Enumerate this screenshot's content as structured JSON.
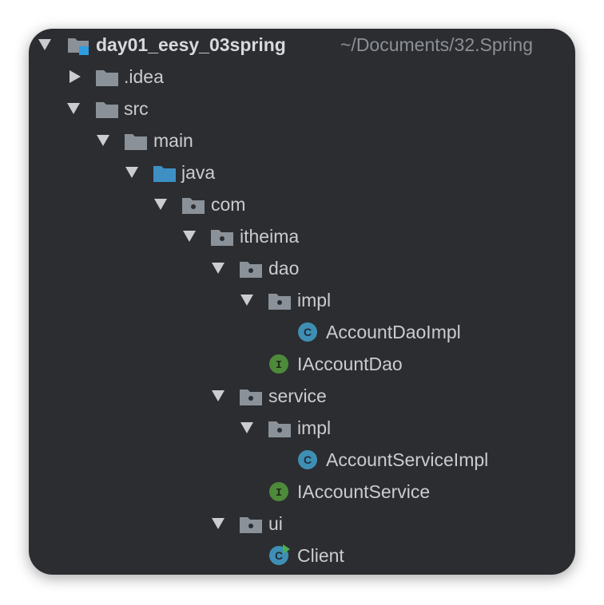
{
  "project": {
    "name": "day01_eesy_03spring",
    "path": "~/Documents/32.Spring"
  },
  "tree": {
    "idea": ".idea",
    "src": "src",
    "main": "main",
    "java": "java",
    "com": "com",
    "itheima": "itheima",
    "dao": "dao",
    "dao_impl": "impl",
    "account_dao_impl": "AccountDaoImpl",
    "iaccount_dao": "IAccountDao",
    "service": "service",
    "service_impl": "impl",
    "account_service_impl": "AccountServiceImpl",
    "iaccount_service": "IAccountService",
    "ui": "ui",
    "client": "Client"
  },
  "icons": {
    "class_badge": "C",
    "interface_badge": "I"
  },
  "colors": {
    "background": "#2b2d30",
    "text": "#c9ccd1",
    "folder": "#8a9199",
    "source_folder": "#3d8fc4",
    "class_icon": "#3f8fb5",
    "interface_icon": "#4d8a3a",
    "run_marker": "#4caf50"
  }
}
